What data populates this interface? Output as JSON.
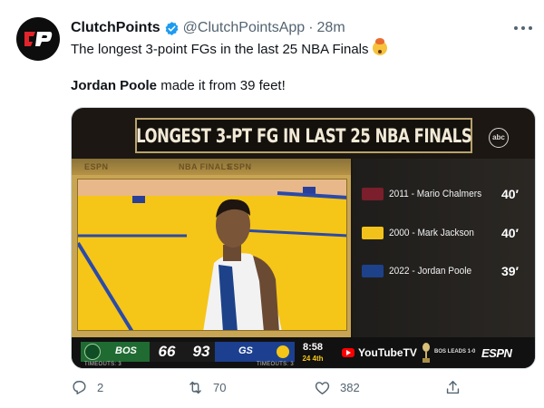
{
  "tweet": {
    "author_name": "ClutchPoints",
    "handle": "@ClutchPointsApp",
    "separator": "·",
    "time": "28m",
    "avatar_text": "CP",
    "text_line1": "The longest 3-point FGs in the last 25 NBA Finals",
    "text_line2_bold": "Jordan Poole",
    "text_line2_rest": " made it from 39 feet!"
  },
  "media": {
    "banner": "LONGEST 3-PT FG IN LAST 25 NBA FINALS",
    "network_logo": "abc",
    "court_header_left": "ESPN",
    "court_header_center": "NBA FINALS",
    "court_header_right": "ESPN",
    "rankings": [
      {
        "label": "2011 - Mario Chalmers",
        "dist": "40′",
        "logo_color": "#7a1f2b"
      },
      {
        "label": "2000 - Mark Jackson",
        "dist": "40′",
        "logo_color": "#f2c21b"
      },
      {
        "label": "2022 - Jordan Poole",
        "dist": "39′",
        "logo_color": "#1d428a"
      }
    ],
    "scoreboard": {
      "team1": "BOS",
      "score1": "66",
      "team2": "GS",
      "score2": "93",
      "clock": "8:58",
      "period": "24  4th",
      "timeouts1": "TIMEOUTS: 3",
      "timeouts2": "TIMEOUTS: 3",
      "youtube": "YouTubeTV",
      "series": "BOS LEADS 1-0",
      "espn": "ESPN"
    }
  },
  "actions": {
    "replies": "2",
    "retweets": "70",
    "likes": "382"
  },
  "colors": {
    "text": "#0f1419",
    "muted": "#536471",
    "verified": "#1d9bf0",
    "court": "#f5c518"
  }
}
